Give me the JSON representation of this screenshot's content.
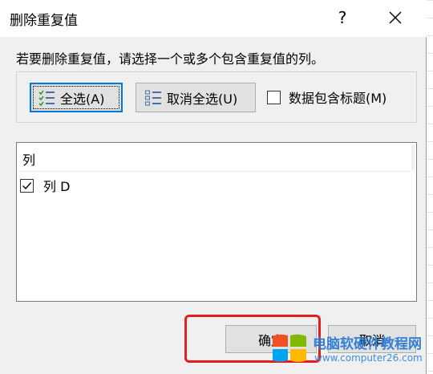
{
  "dialog": {
    "title": "删除重复值",
    "help_label": "?",
    "instruction": "若要删除重复值，请选择一个或多个包含重复值的列。",
    "select_all_label": "全选(A)",
    "unselect_all_label": "取消全选(U)",
    "headers_checkbox_label": "数据包含标题(M)",
    "headers_checked": false,
    "list_header": "列",
    "columns": [
      {
        "label": "列 D",
        "checked": true
      }
    ],
    "ok_label": "确定",
    "cancel_label": "取消"
  },
  "watermark": {
    "line1": "电脑软硬件教程网",
    "line2": "www.computer26.com"
  },
  "colors": {
    "focus_border": "#0078d7",
    "highlight_red": "#e31e1e",
    "watermark_blue": "#2a7cd3"
  }
}
